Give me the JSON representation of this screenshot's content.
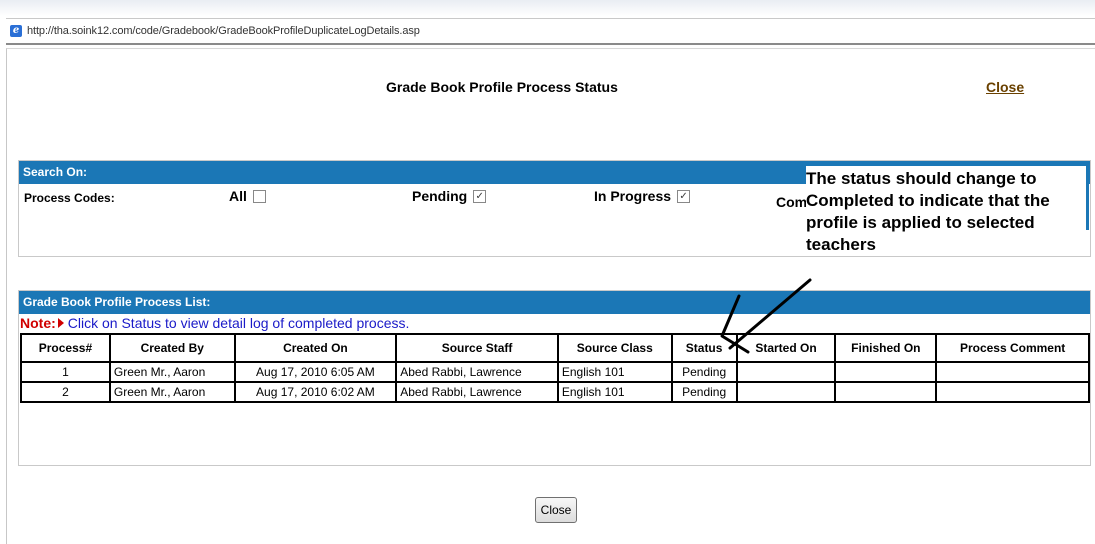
{
  "browser": {
    "url": "http://tha.soink12.com/code/Gradebook/GradeBookProfileDuplicateLogDetails.asp"
  },
  "header": {
    "title": "Grade Book Profile Process Status",
    "close_label": "Close"
  },
  "search": {
    "header": "Search On:",
    "process_codes_label": "Process Codes:",
    "options": [
      {
        "label": "All",
        "checked": false
      },
      {
        "label": "Pending",
        "checked": true
      },
      {
        "label": "In Progress",
        "checked": true
      }
    ],
    "truncated_option": "Com"
  },
  "list": {
    "header": "Grade Book Profile Process List:",
    "note_label": "Note:",
    "note_text": "Click on Status to view detail log of completed process.",
    "columns": [
      "Process#",
      "Created By",
      "Created On",
      "Source Staff",
      "Source Class",
      "Status",
      "Started On",
      "Finished On",
      "Process Comment"
    ],
    "rows": [
      [
        "1",
        "Green Mr., Aaron",
        "Aug 17, 2010 6:05 AM",
        "Abed Rabbi, Lawrence",
        "English 101",
        "Pending",
        "",
        "",
        ""
      ],
      [
        "2",
        "Green Mr., Aaron",
        "Aug 17, 2010 6:02 AM",
        "Abed Rabbi, Lawrence",
        "English 101",
        "Pending",
        "",
        "",
        ""
      ]
    ]
  },
  "annotation": {
    "text": "The status should change to Completed to indicate that the profile is applied to selected teachers"
  },
  "footer": {
    "close_button": "Close"
  },
  "colors": {
    "header_bar": "#1b77b6",
    "note_label": "#d00000",
    "note_text": "#1a1ac8",
    "close_link": "#6a4100"
  }
}
